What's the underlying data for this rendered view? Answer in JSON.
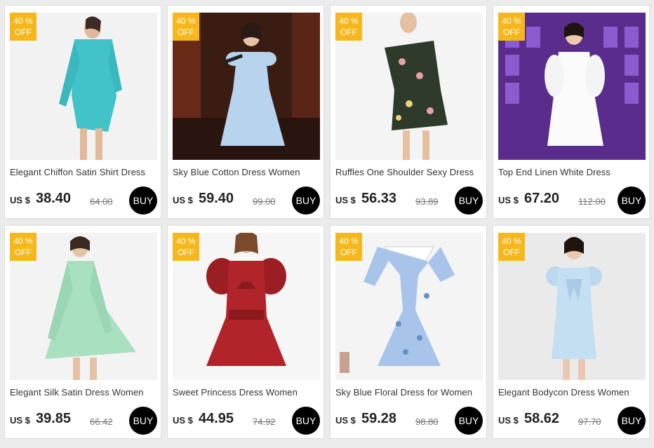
{
  "currency": "US $",
  "buy_label": "BUY",
  "badge_pct": "40 %",
  "badge_off": "OFF",
  "accent_badge": "#f5b71b",
  "products": [
    {
      "title": "Elegant Chiffon Satin Shirt Dress",
      "price": "38.40",
      "old": "64.00",
      "image": "woman-in-turquoise-satin-shirt-dress"
    },
    {
      "title": "Sky Blue Cotton Dress Women",
      "price": "59.40",
      "old": "99.00",
      "image": "woman-in-sky-blue-dress-with-microphone-on-stage"
    },
    {
      "title": "Ruffles One Shoulder Sexy Dress",
      "price": "56.33",
      "old": "93.89",
      "image": "woman-in-floral-one-shoulder-ruffle-dress"
    },
    {
      "title": "Top End Linen White Dress",
      "price": "67.20",
      "old": "112.00",
      "image": "woman-in-white-linen-dress-on-purple-stage"
    },
    {
      "title": "Elegant Silk Satin Dress Women",
      "price": "39.85",
      "old": "66.42",
      "image": "woman-in-mint-green-satin-dress"
    },
    {
      "title": "Sweet Princess Dress Women",
      "price": "44.95",
      "old": "74.92",
      "image": "woman-in-red-puff-sleeve-dress"
    },
    {
      "title": "Sky Blue Floral Dress for Women",
      "price": "59.28",
      "old": "98.80",
      "image": "blue-floral-dress-with-white-collar"
    },
    {
      "title": "Elegant Bodycon Dress Women",
      "price": "58.62",
      "old": "97.70",
      "image": "woman-in-light-blue-bow-dress"
    }
  ]
}
